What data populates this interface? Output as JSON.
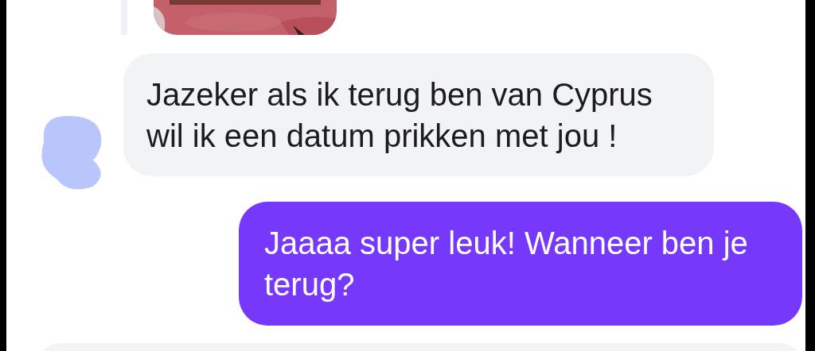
{
  "messages": [
    {
      "kind": "incoming",
      "text": "Jazeker als ik terug ben van Cyprus wil ik een datum prikken met jou !"
    },
    {
      "kind": "outgoing",
      "text": "Jaaaa super leuk! Wanneer ben je terug?"
    }
  ]
}
